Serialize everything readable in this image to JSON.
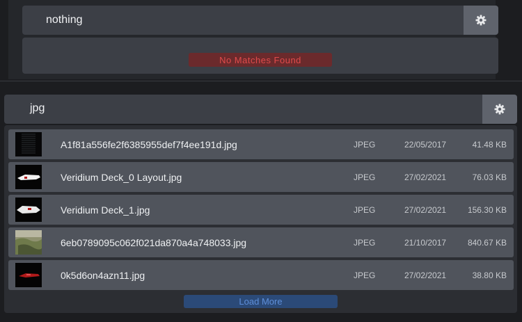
{
  "search_top": {
    "query": "nothing",
    "settings_icon": "gear-icon",
    "no_results_text": "No Matches Found"
  },
  "search_bottom": {
    "query": "jpg",
    "settings_icon": "gear-icon",
    "load_more_label": "Load More",
    "results": [
      {
        "name": "A1f81a556fe2f6385955def7f4ee191d.jpg",
        "type": "JPEG",
        "date": "22/05/2017",
        "size": "41.48 KB"
      },
      {
        "name": "Veridium Deck_0 Layout.jpg",
        "type": "JPEG",
        "date": "27/02/2021",
        "size": "76.03 KB"
      },
      {
        "name": "Veridium Deck_1.jpg",
        "type": "JPEG",
        "date": "27/02/2021",
        "size": "156.30 KB"
      },
      {
        "name": "6eb0789095c062f021da870a4a748033.jpg",
        "type": "JPEG",
        "date": "21/10/2017",
        "size": "840.67 KB"
      },
      {
        "name": "0k5d6on4azn11.jpg",
        "type": "JPEG",
        "date": "27/02/2021",
        "size": "38.80 KB"
      }
    ]
  },
  "colors": {
    "error_text": "#e04b4b",
    "error_bg": "#6b2a2c",
    "load_more_text": "#5e8fda",
    "load_more_bg": "#2b4a78"
  }
}
